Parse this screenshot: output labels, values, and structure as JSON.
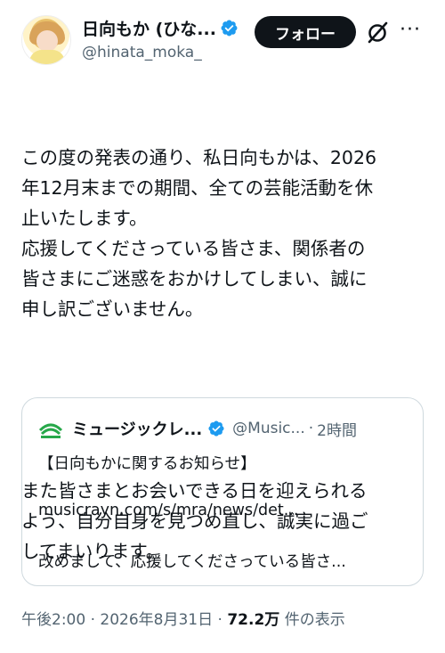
{
  "author": {
    "display_name": "日向もか (ひな...",
    "handle": "@hinata_moka_",
    "follow_label": "フォロー",
    "verified_color": "#1d9bf0"
  },
  "tweet": {
    "paragraphs": [
      "この度の発表の通り、私日向もかは、2026\n年12月末までの期間、全ての芸能活動を休\n止いたします。\n応援してくださっている皆さま、関係者の\n皆さまにご迷惑をおかけしてしまい、誠に\n申し訳ございません。",
      "また皆さまとお会いできる日を迎えられる\nよう、自分自身を見つめ直し、誠実に過ご\nしてまいります。"
    ]
  },
  "quote": {
    "name": "ミュージックレ...",
    "handle": "@Music...",
    "dot": "·",
    "time": "2時間",
    "title": "【日向もかに関するお知らせ】",
    "link": "musicrayn.com/s/mra/news/det...",
    "excerpt": "改めまして、応援してくださっている皆さ...",
    "logo_color": "#27a84a"
  },
  "meta": {
    "time": "午後2:00",
    "sep1": "·",
    "date": "2026年8月31日",
    "sep2": "·",
    "views": "72.2万",
    "views_label": "件の表示"
  },
  "icons": {
    "verified": "verified-badge-icon",
    "grok": "grok-icon",
    "more": "more-icon"
  }
}
